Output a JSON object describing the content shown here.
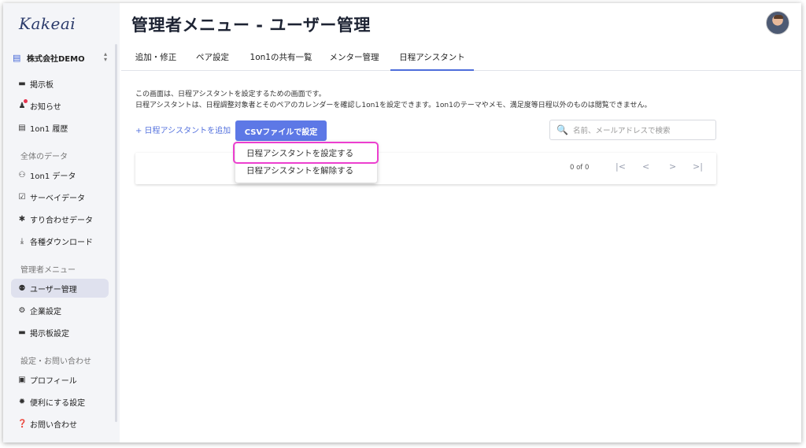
{
  "app": {
    "logo": "Kakeai",
    "page_title": "管理者メニュー - ユーザー管理"
  },
  "sidebar": {
    "company": "株式会社DEMO",
    "items_top": [
      {
        "label": "掲示板",
        "icon": "board-icon"
      },
      {
        "label": "お知らせ",
        "icon": "bell-icon"
      },
      {
        "label": "1on1 履歴",
        "icon": "history-icon"
      }
    ],
    "section_data": "全体のデータ",
    "items_data": [
      {
        "label": "1on1 データ",
        "icon": "people-icon"
      },
      {
        "label": "サーベイデータ",
        "icon": "survey-icon"
      },
      {
        "label": "すり合わせデータ",
        "icon": "puzzle-icon"
      },
      {
        "label": "各種ダウンロード",
        "icon": "download-icon"
      }
    ],
    "section_admin": "管理者メニュー",
    "items_admin": [
      {
        "label": "ユーザー管理",
        "icon": "user-manage-icon",
        "active": true
      },
      {
        "label": "企業設定",
        "icon": "company-settings-icon"
      },
      {
        "label": "掲示板設定",
        "icon": "board-settings-icon"
      }
    ],
    "section_settings": "設定・お問い合わせ",
    "items_settings": [
      {
        "label": "プロフィール",
        "icon": "profile-icon"
      },
      {
        "label": "便利にする設定",
        "icon": "gear-icon"
      },
      {
        "label": "お問い合わせ",
        "icon": "question-icon"
      }
    ]
  },
  "tabs": [
    {
      "label": "追加・修正"
    },
    {
      "label": "ペア設定"
    },
    {
      "label": "1on1の共有一覧"
    },
    {
      "label": "メンター管理"
    },
    {
      "label": "日程アシスタント",
      "active": true
    }
  ],
  "main": {
    "desc_line1": "この画面は、日程アシスタントを設定するための画面です。",
    "desc_line2": "日程アシスタントは、日程調整対象者とそのペアのカレンダーを確認し1on1を設定できます。1on1のテーマやメモ、満足度等日程以外のものは閲覧できません。",
    "add_link": "+ 日程アシスタントを追加",
    "csv_button": "CSVファイルで設定",
    "search_placeholder": "名前、メールアドレスで検索",
    "page_count": "0 of 0",
    "pager": {
      "first": "|<",
      "prev": "<",
      "next": ">",
      "last": ">|"
    }
  },
  "dropdown": {
    "items": [
      {
        "label": "日程アシスタントを設定する",
        "highlighted": true
      },
      {
        "label": "日程アシスタントを解除する"
      }
    ],
    "highlight_color": "#ec3fcf"
  },
  "colors": {
    "accent": "#5d78e6",
    "active_nav_bg": "#dfe1ee"
  }
}
